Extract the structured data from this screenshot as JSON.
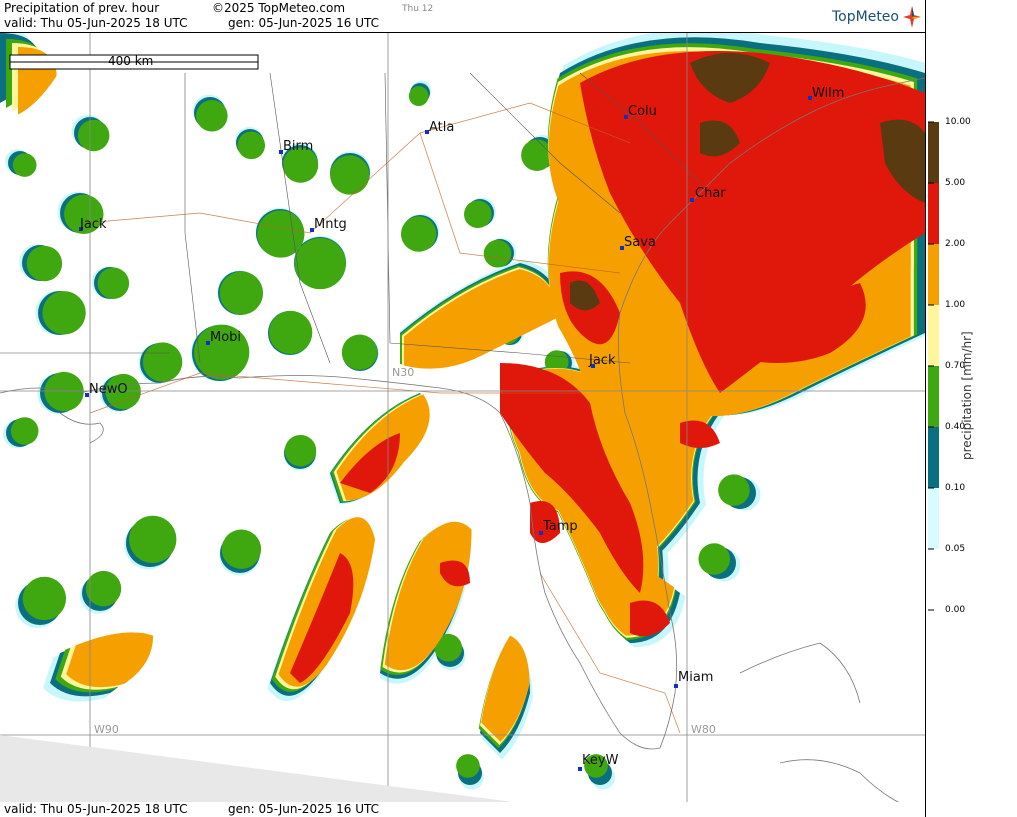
{
  "header": {
    "title": "Precipitation of prev. hour",
    "copyright": "©2025 TopMeteo.com",
    "valid": "valid:  Thu  05-Jun-2025  18 UTC",
    "gen": "gen:  05-Jun-2025  16 UTC",
    "day_tab": "Thu 12",
    "logo": "TopMeteo"
  },
  "footer": {
    "valid": "valid:  Thu  05-Jun-2025  18 UTC",
    "gen": "gen:  05-Jun-2025  16 UTC"
  },
  "scale_bar": "400 km",
  "colorbar": {
    "title": "precipitation  [mm/hr]",
    "ticks": [
      "10.00",
      "5.00",
      "2.00",
      "1.00",
      "0.70",
      "0.40",
      "0.10",
      "0.05",
      "0.00"
    ],
    "colors": [
      "#5a3a10",
      "#e0180c",
      "#f5a000",
      "#fff59a",
      "#3fa810",
      "#0a7080",
      "#d8fbff"
    ]
  },
  "cities": [
    {
      "name": "Atla"
    },
    {
      "name": "Birm"
    },
    {
      "name": "Colu"
    },
    {
      "name": "Wilm"
    },
    {
      "name": "Char"
    },
    {
      "name": "Mntg"
    },
    {
      "name": "Jack"
    },
    {
      "name": "Sava"
    },
    {
      "name": "Mobi"
    },
    {
      "name": "Jack"
    },
    {
      "name": "NewO"
    },
    {
      "name": "Tamp"
    },
    {
      "name": "Miam"
    },
    {
      "name": "KeyW"
    }
  ],
  "grid_labels": {
    "w90": "W90",
    "w80": "W80",
    "n30": "N30"
  }
}
